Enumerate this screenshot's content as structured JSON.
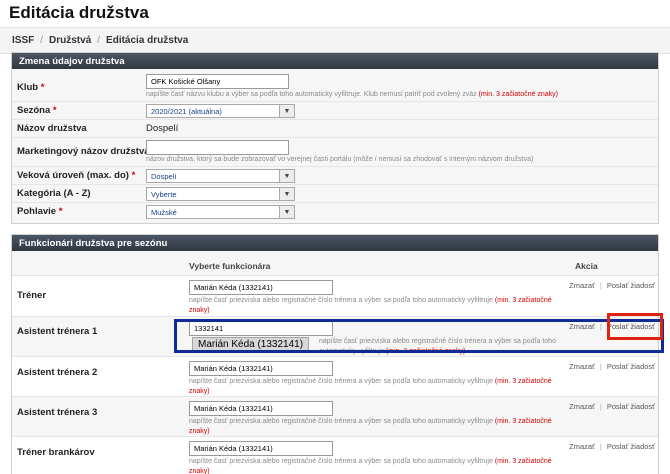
{
  "page": {
    "title": "Editácia družstva"
  },
  "breadcrumb": [
    "ISSF",
    "Družstvá",
    "Editácia družstva"
  ],
  "team_panel": {
    "header": "Zmena údajov družstva",
    "club": {
      "label": "Klub",
      "value": "OFK Košické Olšany",
      "hint": "napíšte časť názvu klubu a výber sa podľa toho automaticky vyfiltruje. Klub nemusí patriť pod zvolený zväz",
      "hint_red": "(min. 3 začiatočné znaky)"
    },
    "season": {
      "label": "Sezóna",
      "value": "2020/2021 (aktuálna)"
    },
    "team_name": {
      "label": "Názov družstva",
      "value": "Dospelí"
    },
    "marketing": {
      "label": "Marketingový názov družstva",
      "value": "",
      "hint": "názov družstva, ktorý sa bude zobrazovať vo verejnej časti portálu (môže / nemusí sa zhodovať s interným názvom družstva)"
    },
    "age": {
      "label": "Veková úroveň (max. do)",
      "value": "Dospelí"
    },
    "category": {
      "label": "Kategória (A - Z)",
      "value": "Vyberte"
    },
    "gender": {
      "label": "Pohlavie",
      "value": "Mužské"
    }
  },
  "officials_panel": {
    "header": "Funkcionári družstva pre sezónu",
    "col_select": "Vyberte funkcionára",
    "col_action": "Akcia",
    "hint": "napíšte časť priezviska alebo registračné číslo trénera a výber sa podľa toho automaticky vyfiltruje",
    "hint_red": "(min. 3 začiatočné znaky)",
    "delete_label": "Zmazať",
    "request_label": "Poslať žiadosť",
    "rows": [
      {
        "role": "Tréner",
        "value": "Marián Kéda (1332141)"
      },
      {
        "role": "Asistent trénera 1",
        "value": "1332141",
        "suggestion": "Marián Kéda (1332141)"
      },
      {
        "role": "Asistent trénera 2",
        "value": "Marián Kéda (1332141)"
      },
      {
        "role": "Asistent trénera 3",
        "value": "Marián Kéda (1332141)"
      },
      {
        "role": "Tréner brankárov",
        "value": "Marián Kéda (1332141)"
      }
    ]
  }
}
